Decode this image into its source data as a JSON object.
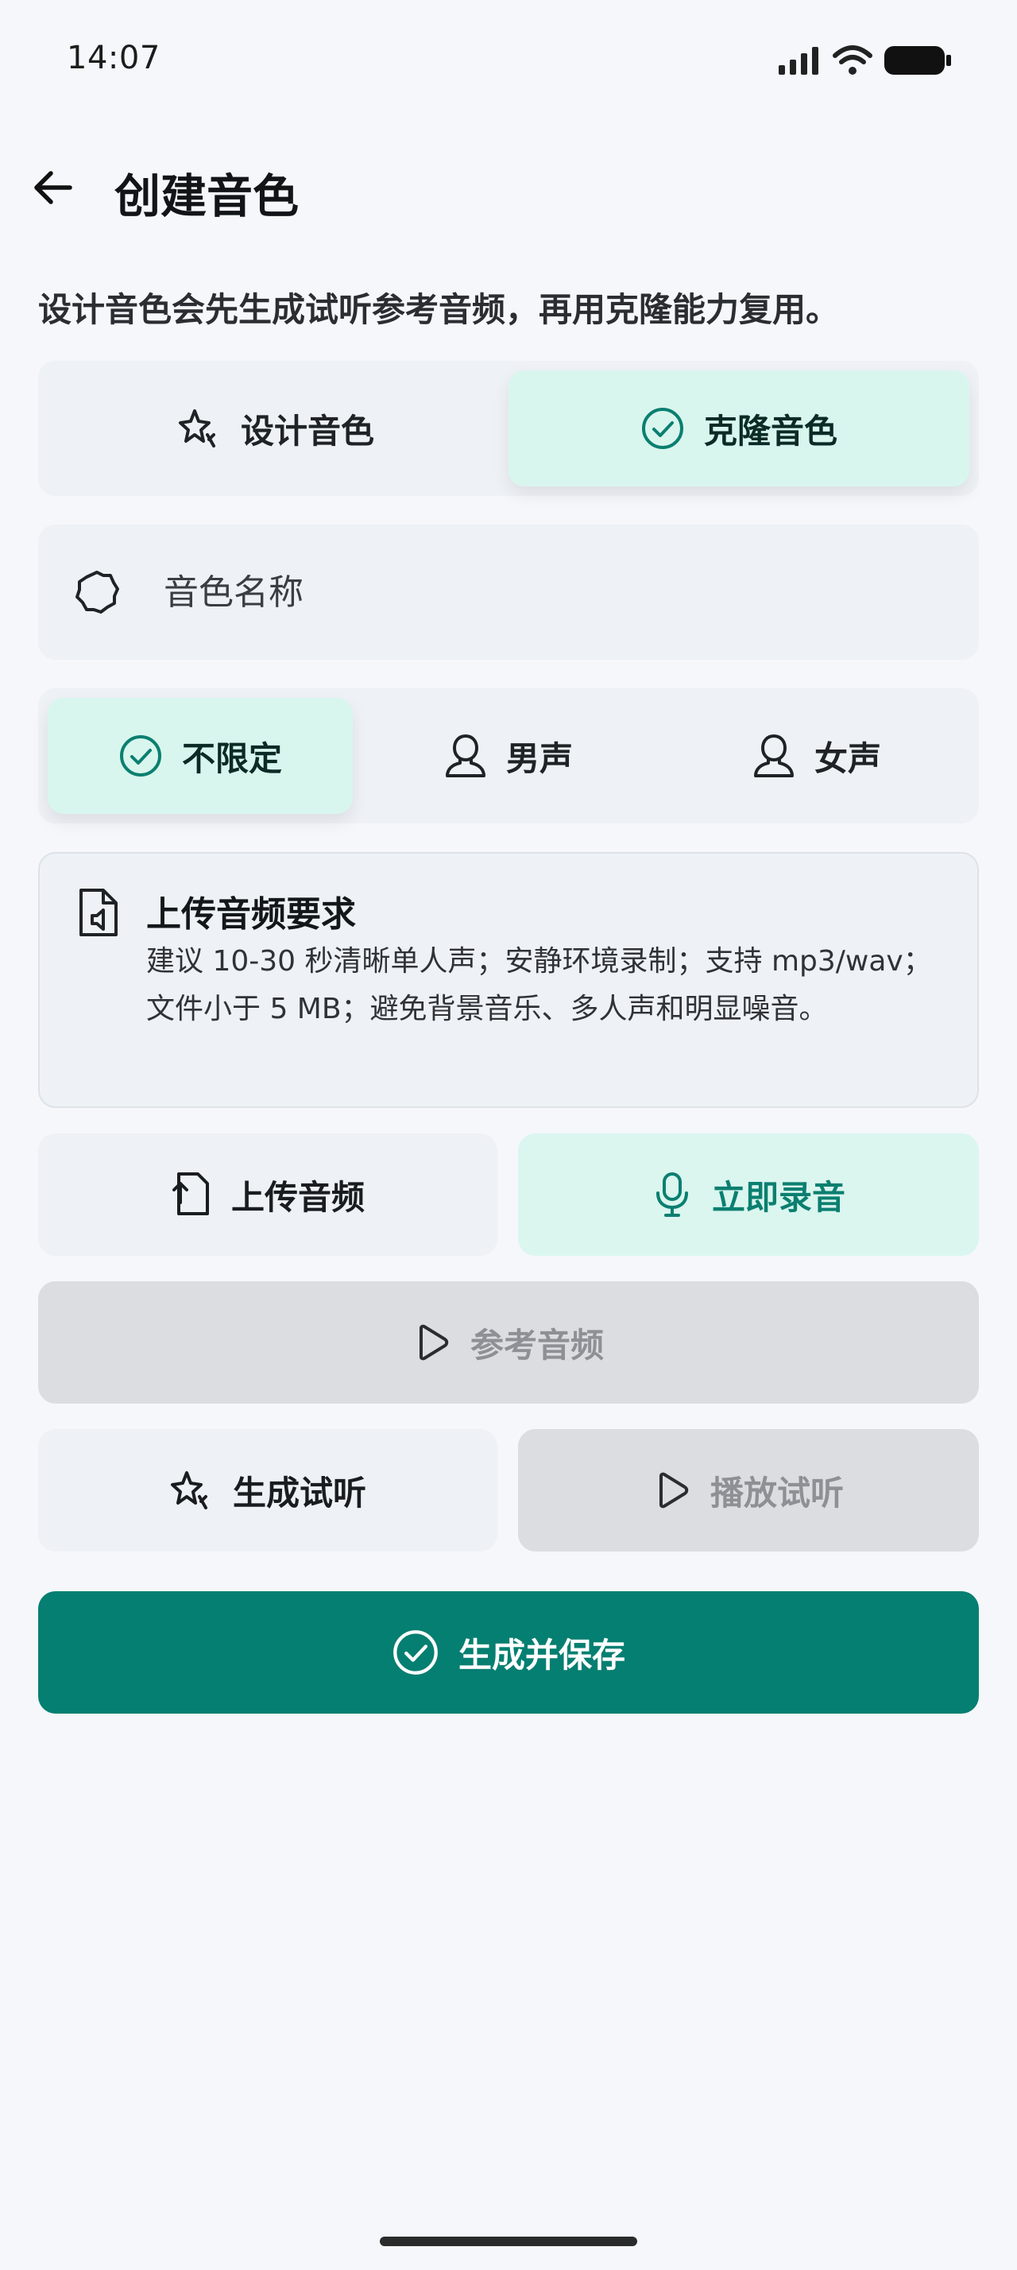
{
  "status_bar": {
    "time": "14:07"
  },
  "header": {
    "title": "创建音色"
  },
  "description": "设计音色会先生成试听参考音频，再用克隆能力复用。",
  "mode_tabs": [
    {
      "label": "设计音色",
      "icon": "sparkle-icon",
      "selected": false
    },
    {
      "label": "克隆音色",
      "icon": "check-circle-icon",
      "selected": true
    }
  ],
  "name_field": {
    "placeholder": "音色名称",
    "value": ""
  },
  "gender_options": [
    {
      "label": "不限定",
      "icon": "check-circle-icon",
      "selected": true
    },
    {
      "label": "男声",
      "icon": "person-icon",
      "selected": false
    },
    {
      "label": "女声",
      "icon": "person-icon",
      "selected": false
    }
  ],
  "requirements": {
    "title": "上传音频要求",
    "text": "建议 10-30 秒清晰单人声；安静环境录制；支持 mp3/wav；文件小于 5 MB；避免背景音乐、多人声和明显噪音。"
  },
  "actions": {
    "upload": "上传音频",
    "record": "立即录音",
    "reference": "参考音频",
    "generate": "生成试听",
    "play": "播放试听",
    "save": "生成并保存"
  },
  "colors": {
    "accent": "#057F71",
    "mint": "#D9F6EE",
    "background": "#F5F7FA",
    "surface": "#EEF1F5",
    "disabled": "#DCDDE1"
  }
}
